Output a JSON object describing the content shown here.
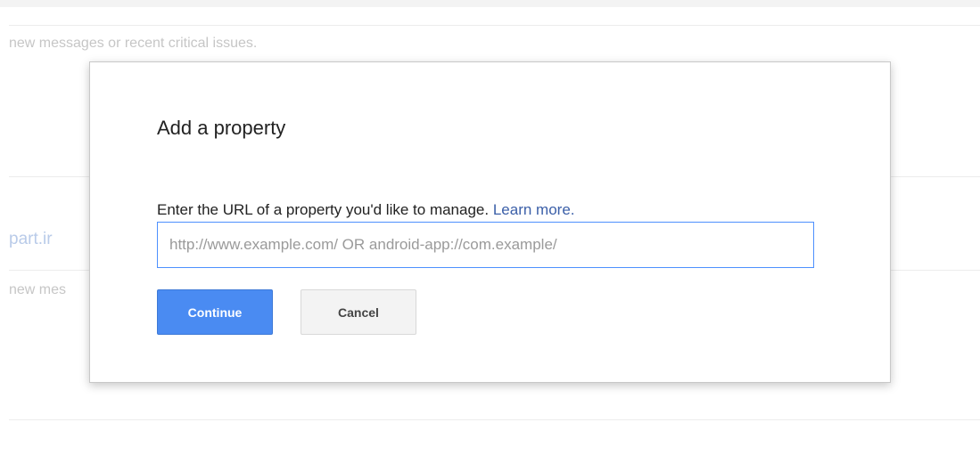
{
  "background": {
    "row1_text": "new messages or recent critical issues.",
    "site_link": "part.ir",
    "row2_text": "new mes"
  },
  "dialog": {
    "title": "Add a property",
    "instruction": "Enter the URL of a property you'd like to manage.",
    "learn_more": "Learn more.",
    "url_input": {
      "value": "",
      "placeholder": "http://www.example.com/ OR android-app://com.example/"
    },
    "continue_label": "Continue",
    "cancel_label": "Cancel"
  },
  "colors": {
    "primary_button": "#4a8bf2",
    "link": "#3b5fa8",
    "input_focus_border": "#4d90fe"
  }
}
